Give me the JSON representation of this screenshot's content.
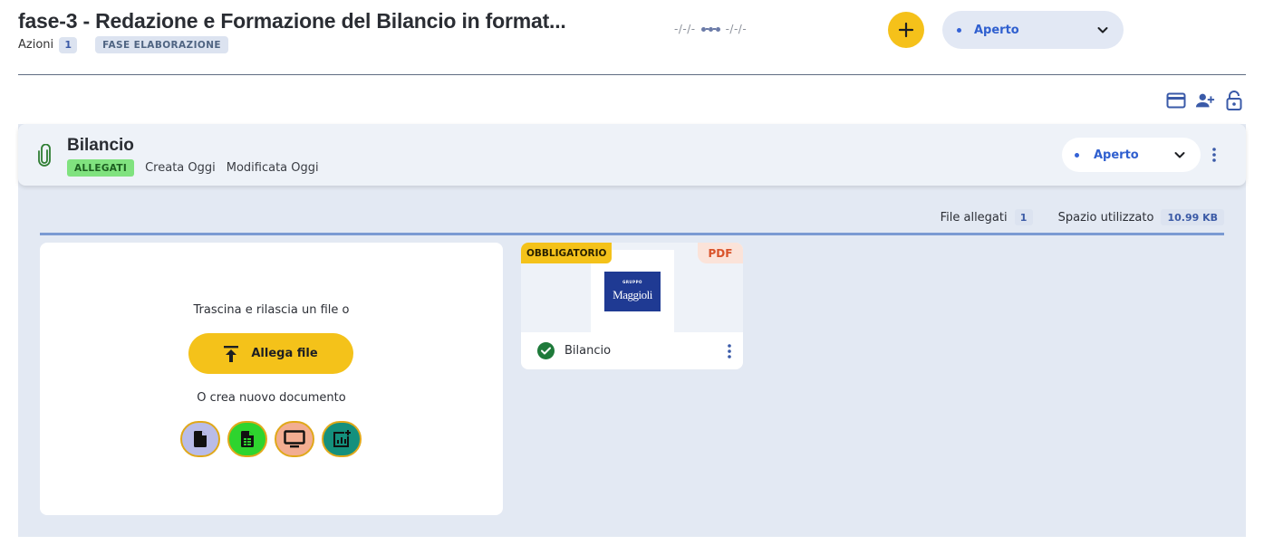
{
  "header": {
    "title": "fase-3 - Redazione e Formazione del Bilancio in format...",
    "actions_label": "Azioni",
    "actions_count": "1",
    "phase_badge": "FASE ELABORAZIONE",
    "date_start": "-/-/-",
    "date_end": "-/-/-",
    "status": "Aperto"
  },
  "toolbar": {
    "icons": [
      "credit-card-icon",
      "add-user-icon",
      "lock-open-icon"
    ]
  },
  "card": {
    "title": "Bilancio",
    "badge": "ALLEGATI",
    "created": "Creata Oggi",
    "modified": "Modificata Oggi",
    "status": "Aperto"
  },
  "stats": {
    "files_label": "File allegati",
    "files_count": "1",
    "space_label": "Spazio utilizzato",
    "space_value": "10.99 KB"
  },
  "dropzone": {
    "drag_text": "Trascina e rilascia un file o",
    "attach_label": "Allega file",
    "create_text": "O crea nuovo documento",
    "doc_types": [
      {
        "name": "document",
        "color": "#b9bce8"
      },
      {
        "name": "spreadsheet",
        "color": "#2ed42e"
      },
      {
        "name": "presentation",
        "color": "#f2ad91"
      },
      {
        "name": "chart",
        "color": "#14907d"
      }
    ]
  },
  "file": {
    "mandatory": "OBBLIGATORIO",
    "type": "PDF",
    "logo_top": "GRUPPO",
    "logo_name": "Maggioli",
    "name": "Bilancio"
  },
  "colors": {
    "accent_yellow": "#f4c21a",
    "accent_blue": "#2f5fcf",
    "panel_bg": "#e3e9f3"
  }
}
